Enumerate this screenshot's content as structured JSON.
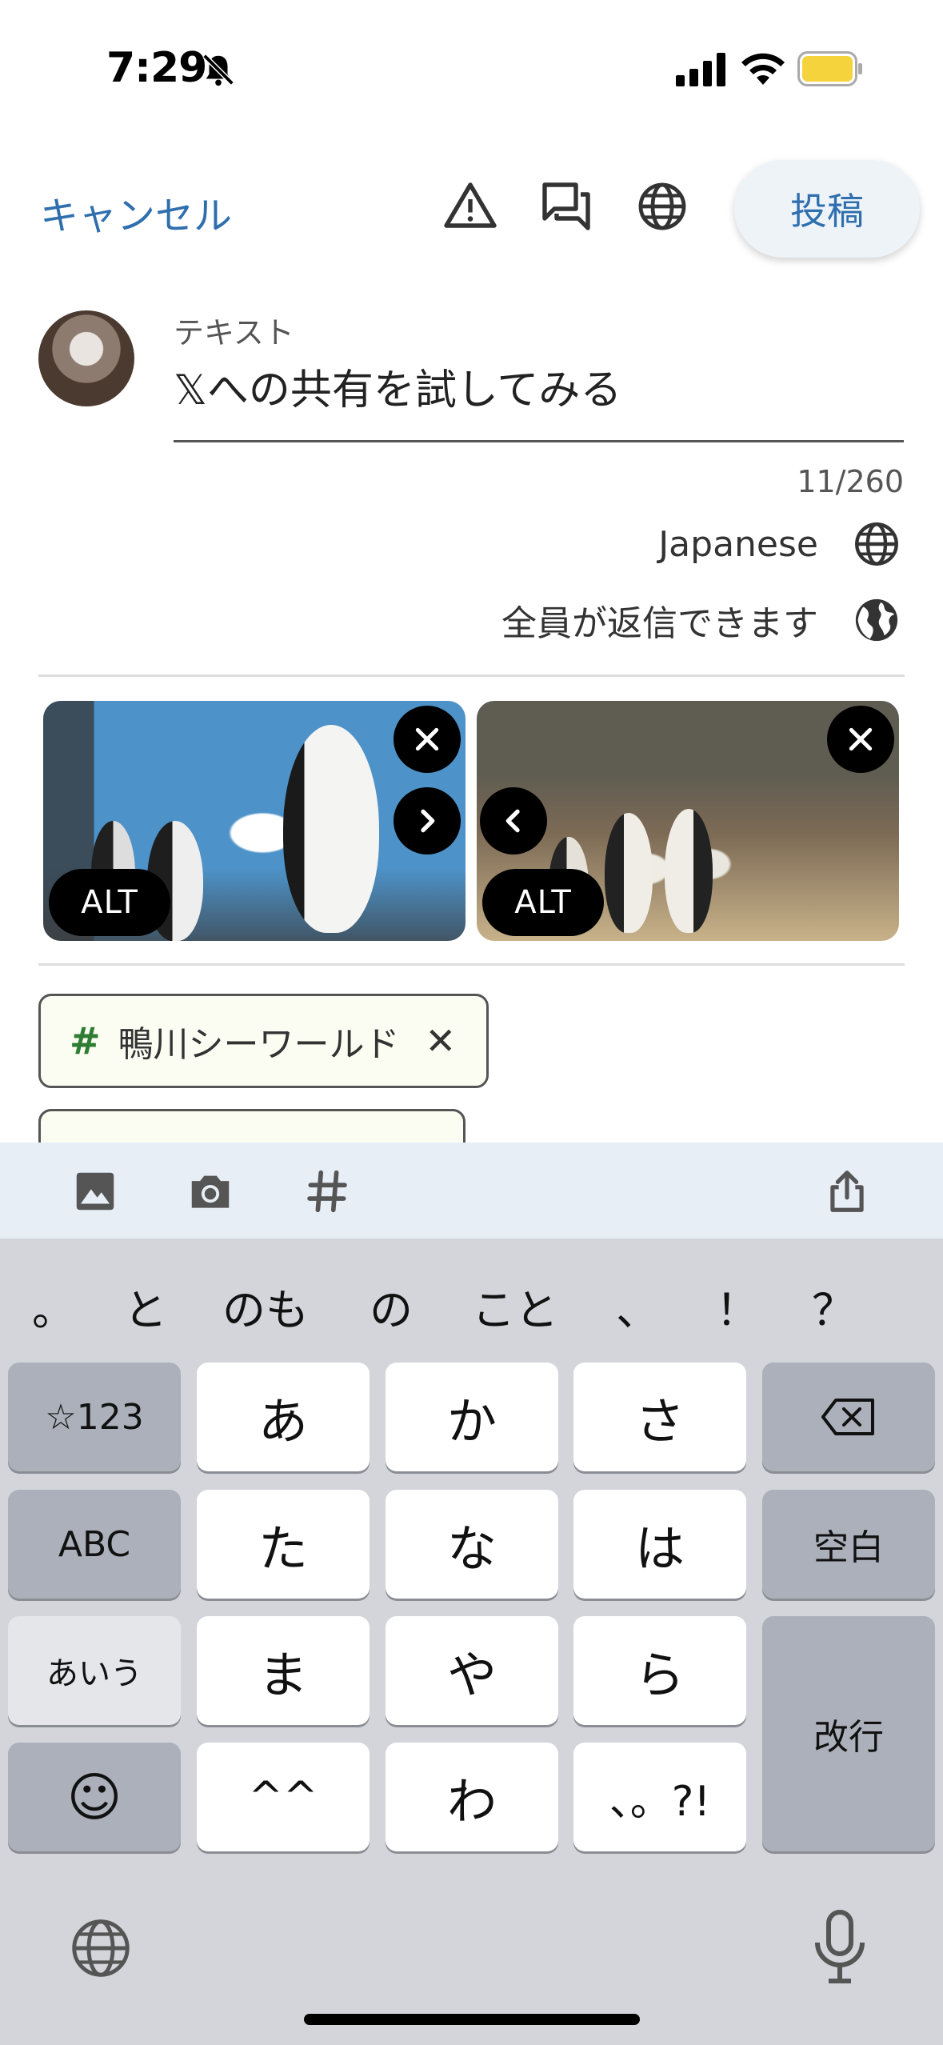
{
  "status_bar": {
    "time": "7:29",
    "battery_color": "#f5d33c"
  },
  "header": {
    "cancel_label": "キャンセル",
    "post_label": "投稿",
    "accent": "#2f6fae"
  },
  "compose": {
    "field_label": "テキスト",
    "text": "𝕏への共有を試してみる",
    "counter": "11/260",
    "language": "Japanese",
    "reply_setting": "全員が返信できます"
  },
  "images": [
    {
      "alt_label": "ALT",
      "subject": "penguins in aquarium"
    },
    {
      "alt_label": "ALT",
      "subject": "penguins on rocks"
    }
  ],
  "tags": [
    {
      "label": "鴨川シーワールド"
    },
    {
      "label": ""
    }
  ],
  "toolbar": {
    "icons": [
      "image-icon",
      "camera-icon",
      "hashtag-icon",
      "share-icon"
    ]
  },
  "keyboard": {
    "candidates": [
      "。",
      "と",
      "のも",
      "の",
      "こと",
      "、",
      "！",
      "？"
    ],
    "rows": [
      [
        "☆123",
        "あ",
        "か",
        "さ",
        "⌫"
      ],
      [
        "ABC",
        "た",
        "な",
        "は",
        "空白"
      ],
      [
        "あいう",
        "ま",
        "や",
        "ら",
        "改行"
      ],
      [
        "☺",
        "^^",
        "わ",
        "、。?!"
      ]
    ]
  }
}
